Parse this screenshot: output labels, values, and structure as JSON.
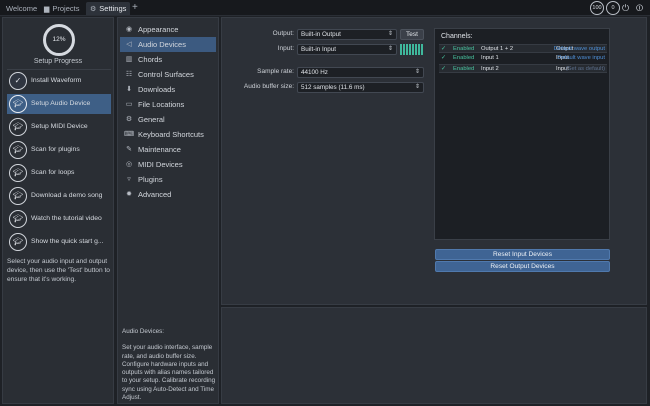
{
  "tabs": [
    {
      "label": "Welcome",
      "icon": ""
    },
    {
      "label": "Projects",
      "icon": "folder-icon"
    },
    {
      "label": "Settings",
      "icon": "gear-icon"
    }
  ],
  "top_right": {
    "cpu": "100",
    "count": "0"
  },
  "setup": {
    "progress_value": "12%",
    "progress_label": "Setup Progress",
    "steps": [
      {
        "label": "Install Waveform",
        "state": "done"
      },
      {
        "label": "Setup Audio Device",
        "state": "active"
      },
      {
        "label": "Setup MIDI Device",
        "state": "todo"
      },
      {
        "label": "Scan for plugins",
        "state": "todo"
      },
      {
        "label": "Scan for loops",
        "state": "todo"
      },
      {
        "label": "Download a demo song",
        "state": "todo"
      },
      {
        "label": "Watch the tutorial video",
        "state": "todo"
      },
      {
        "label": "Show the quick start g...",
        "state": "todo"
      }
    ],
    "hint": "Select your audio input and output device, then use the 'Test' button to ensure that it's working."
  },
  "nav": {
    "items": [
      {
        "label": "Appearance",
        "icon": "eye-icon"
      },
      {
        "label": "Audio Devices",
        "icon": "speaker-icon"
      },
      {
        "label": "Chords",
        "icon": "chords-icon"
      },
      {
        "label": "Control Surfaces",
        "icon": "control-surface-icon"
      },
      {
        "label": "Downloads",
        "icon": "download-icon"
      },
      {
        "label": "File Locations",
        "icon": "folder-icon"
      },
      {
        "label": "General",
        "icon": "gear-icon"
      },
      {
        "label": "Keyboard Shortcuts",
        "icon": "keyboard-icon"
      },
      {
        "label": "Maintenance",
        "icon": "wrench-icon"
      },
      {
        "label": "MIDI Devices",
        "icon": "midi-icon"
      },
      {
        "label": "Plugins",
        "icon": "plugin-icon"
      },
      {
        "label": "Advanced",
        "icon": "advanced-gear-icon"
      }
    ],
    "active_index": 1,
    "description_title": "Audio Devices:",
    "description": "Set your audio interface, sample rate, and audio buffer size. Configure hardware inputs and outputs with alias names tailored to your setup. Calibrate recording sync using Auto-Detect and Time Adjust."
  },
  "audio": {
    "output_label": "Output:",
    "output_value": "Built-in Output",
    "test_label": "Test",
    "input_label": "Input:",
    "input_value": "Built-in Input",
    "input_meter_level": 1.0,
    "sample_rate_label": "Sample rate:",
    "sample_rate_value": "44100 Hz",
    "buffer_label": "Audio buffer size:",
    "buffer_value": "512 samples (11.6 ms)"
  },
  "channels": {
    "title": "Channels:",
    "rows": [
      {
        "check": "✓",
        "enabled": "Enabled",
        "name": "Output 1 + 2",
        "direction": "Output",
        "device": "Default wave output",
        "dim": false
      },
      {
        "check": "✓",
        "enabled": "Enabled",
        "name": "Input 1",
        "direction": "Input",
        "device": "Default wave input",
        "dim": false
      },
      {
        "check": "✓",
        "enabled": "Enabled",
        "name": "Input 2",
        "direction": "Input",
        "device": "(Set as default)",
        "dim": true
      }
    ]
  },
  "buttons": {
    "reset_input": "Reset Input Devices",
    "reset_output": "Reset Output Devices"
  }
}
